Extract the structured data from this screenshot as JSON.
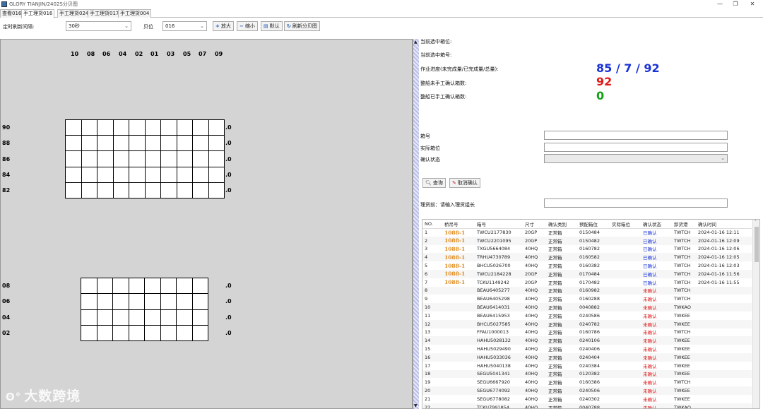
{
  "window": {
    "title": "GLORY TIANJIN/2402S分贝图",
    "min": "—",
    "max": "❐",
    "close": "✕"
  },
  "tabs": [
    "查看016",
    "手工理货016",
    "手工理货024",
    "手工理货017",
    "手工理货004"
  ],
  "toolbar": {
    "refresh_label": "定时刷新间隔:",
    "refresh_value": "30秒",
    "bay_label": "贝位",
    "bay_value": "016",
    "zoom_in": "放大",
    "zoom_out": "缩小",
    "default": "默认",
    "refresh_btn": "刷新分贝图"
  },
  "bay_plan": {
    "columns": [
      "10",
      "08",
      "06",
      "04",
      "02",
      "01",
      "03",
      "05",
      "07",
      "09"
    ],
    "deck_rows": [
      "90",
      "88",
      "86",
      "84",
      "82"
    ],
    "hold_rows": [
      "08",
      "06",
      "04",
      "02"
    ],
    "zero": ".0"
  },
  "info": {
    "selected_slot_label": "当前选中箱位:",
    "selected_container_label": "当前选中箱号:",
    "progress_label": "作业进度(未完成量/已完成量/总量):",
    "progress": {
      "pending": "85",
      "sep1": "/",
      "done": "7",
      "sep2": "/",
      "total": "92"
    },
    "unconfirmed_label": "整船未手工确认箱数:",
    "unconfirmed_value": "92",
    "confirmed_label": "整船已手工确认箱数:",
    "confirmed_value": "0"
  },
  "form": {
    "container_no_label": "箱号",
    "actual_slot_label": "实际箱位",
    "confirm_status_label": "确认状态",
    "query_btn": "查询",
    "cancel_btn": "取消确认",
    "tally_label": "理货前：请输入理货组长"
  },
  "colors": {
    "progress": "#1a33d6",
    "unconfirmed": "#e01919",
    "confirmed": "#15a015",
    "bridge": "#e08a1c"
  },
  "table": {
    "headers": [
      "NO.",
      "桥吊号",
      "箱号",
      "尺寸",
      "确认类别",
      "预配箱位",
      "实际箱位",
      "确认状态",
      "卸货港",
      "确认时间"
    ],
    "rows": [
      [
        "1",
        "1088-1",
        "TWCU2177830",
        "20GP",
        "正常箱",
        "0150484",
        "",
        "已确认",
        "TWTCH",
        "2024-01-16 12:11"
      ],
      [
        "2",
        "1088-1",
        "TWCU2201095",
        "20GP",
        "正常箱",
        "0150482",
        "",
        "已确认",
        "TWTCH",
        "2024-01-16 12:09"
      ],
      [
        "3",
        "1088-1",
        "TXGU5664084",
        "40HQ",
        "正常箱",
        "0160782",
        "",
        "已确认",
        "TWTCH",
        "2024-01-16 12:06"
      ],
      [
        "4",
        "1088-1",
        "TRHU4730789",
        "40HQ",
        "正常箱",
        "0160582",
        "",
        "已确认",
        "TWTCH",
        "2024-01-16 12:05"
      ],
      [
        "5",
        "1088-1",
        "BHCU5026700",
        "40HQ",
        "正常箱",
        "0160382",
        "",
        "已确认",
        "TWTCH",
        "2024-01-16 12:03"
      ],
      [
        "6",
        "1088-1",
        "TWCU2184228",
        "20GP",
        "正常箱",
        "0170484",
        "",
        "已确认",
        "TWTCH",
        "2024-01-16 11:56"
      ],
      [
        "7",
        "1088-1",
        "TCKU1149242",
        "20GP",
        "正常箱",
        "0170482",
        "",
        "已确认",
        "TWTCH",
        "2024-01-16 11:55"
      ],
      [
        "8",
        "",
        "BEAU6405277",
        "40HQ",
        "正常箱",
        "0160982",
        "",
        "未确认",
        "TWTCH",
        ""
      ],
      [
        "9",
        "",
        "BEAU6405298",
        "40HQ",
        "正常箱",
        "0160288",
        "",
        "未确认",
        "TWTCH",
        ""
      ],
      [
        "10",
        "",
        "BEAU6414031",
        "40HQ",
        "正常箱",
        "0040882",
        "",
        "未确认",
        "TWKAO",
        ""
      ],
      [
        "11",
        "",
        "BEAU6415953",
        "40HQ",
        "正常箱",
        "0240586",
        "",
        "未确认",
        "TWKEE",
        ""
      ],
      [
        "12",
        "",
        "BHCU5027585",
        "40HQ",
        "正常箱",
        "0240782",
        "",
        "未确认",
        "TWKEE",
        ""
      ],
      [
        "13",
        "",
        "FFAU1000013",
        "40HQ",
        "正常箱",
        "0160786",
        "",
        "未确认",
        "TWTCH",
        ""
      ],
      [
        "14",
        "",
        "HAHU5028132",
        "40HQ",
        "正常箱",
        "0240106",
        "",
        "未确认",
        "TWKEE",
        ""
      ],
      [
        "15",
        "",
        "HAHU5029490",
        "40HQ",
        "正常箱",
        "0240406",
        "",
        "未确认",
        "TWKEE",
        ""
      ],
      [
        "16",
        "",
        "HAHU5033036",
        "40HQ",
        "正常箱",
        "0240404",
        "",
        "未确认",
        "TWKEE",
        ""
      ],
      [
        "17",
        "",
        "HAHU5040138",
        "40HQ",
        "正常箱",
        "0240384",
        "",
        "未确认",
        "TWKEE",
        ""
      ],
      [
        "18",
        "",
        "SEGU5041341",
        "40HQ",
        "正常箱",
        "0120382",
        "",
        "未确认",
        "TWKEE",
        ""
      ],
      [
        "19",
        "",
        "SEGU6667920",
        "40HQ",
        "正常箱",
        "0160386",
        "",
        "未确认",
        "TWTCH",
        ""
      ],
      [
        "20",
        "",
        "SEGU6774092",
        "40HQ",
        "正常箱",
        "0240506",
        "",
        "未确认",
        "TWKEE",
        ""
      ],
      [
        "21",
        "",
        "SEGU6778082",
        "40HQ",
        "正常箱",
        "0240302",
        "",
        "未确认",
        "TWKEE",
        ""
      ],
      [
        "22",
        "",
        "TCKU7991854",
        "40HQ",
        "正常箱",
        "0040788",
        "",
        "未确认",
        "TWKAO",
        ""
      ]
    ]
  },
  "watermark": {
    "logo": "ʘ°",
    "text": "大数跨境"
  }
}
